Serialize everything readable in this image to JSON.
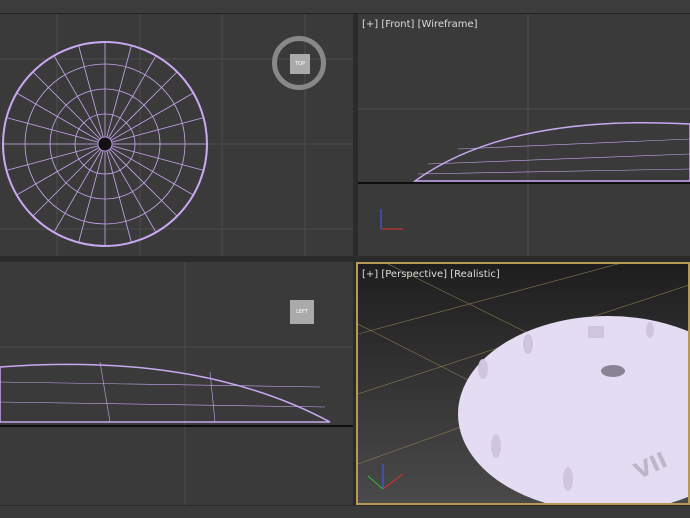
{
  "viewports": {
    "top": {
      "label": "",
      "viewcube": "TOP"
    },
    "front": {
      "label": "[+] [Front] [Wireframe]"
    },
    "left": {
      "label": "",
      "viewcube": "LEFT"
    },
    "perspective": {
      "label": "[+] [Perspective] [Realistic]",
      "active": true
    }
  },
  "colors": {
    "wireframe": "#c8a8f0",
    "active_border": "#b59a55",
    "solid": "#e4dcf2"
  },
  "axes": {
    "x": "x",
    "y": "y",
    "z": "z"
  }
}
